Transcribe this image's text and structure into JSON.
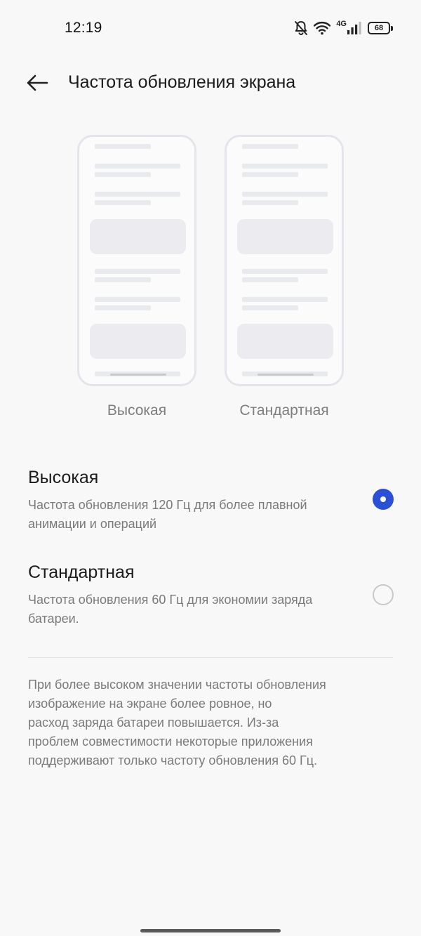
{
  "status_bar": {
    "time": "12:19",
    "network_label": "4G",
    "battery_level": "68",
    "icons": [
      "bell-muted-icon",
      "wifi-icon",
      "signal-icon",
      "battery-icon"
    ]
  },
  "header": {
    "back_icon": "arrow-left-icon",
    "title": "Частота обновления экрана"
  },
  "previews": {
    "high_label": "Высокая",
    "standard_label": "Стандартная"
  },
  "options": [
    {
      "title": "Высокая",
      "description": "Частота обновления 120 Гц для более плавной анимации и операций",
      "selected": true
    },
    {
      "title": "Стандартная",
      "description": "Частота обновления 60 Гц для экономии заряда батареи.",
      "selected": false
    }
  ],
  "note": {
    "lines": [
      "При более высоком значении частоты обновления",
      "изображение на экране более ровное, но",
      "расход заряда батареи повышается. Из-за",
      "проблем совместимости некоторые приложения",
      "поддерживают только частоту обновления 60 Гц."
    ]
  },
  "colors": {
    "accent": "#2a50d6",
    "background": "#f8f8f8",
    "secondary_text": "#7a7a7a"
  }
}
